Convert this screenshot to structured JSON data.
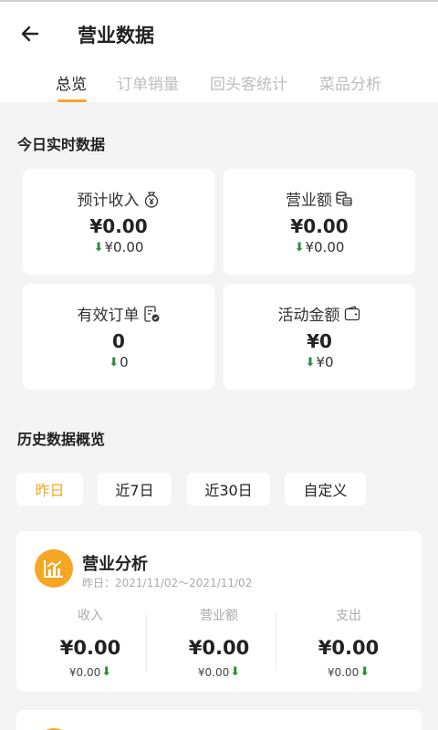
{
  "header": {
    "title": "营业数据",
    "tabs": [
      {
        "label": "总览",
        "active": true
      },
      {
        "label": "订单销量",
        "active": false
      },
      {
        "label": "回头客统计",
        "active": false
      },
      {
        "label": "菜品分析",
        "active": false
      }
    ]
  },
  "realtime": {
    "title": "今日实时数据",
    "cards": [
      {
        "label": "预计收入",
        "icon": "money-bag-icon",
        "value": "¥0.00",
        "delta": "¥0.00"
      },
      {
        "label": "营业额",
        "icon": "coins-icon",
        "value": "¥0.00",
        "delta": "¥0.00"
      },
      {
        "label": "有效订单",
        "icon": "order-check-icon",
        "value": "0",
        "delta": "0"
      },
      {
        "label": "活动金额",
        "icon": "wallet-icon",
        "value": "¥0",
        "delta": "¥0"
      }
    ]
  },
  "history": {
    "title": "历史数据概览",
    "ranges": [
      {
        "label": "昨日",
        "active": true
      },
      {
        "label": "近7日",
        "active": false
      },
      {
        "label": "近30日",
        "active": false
      },
      {
        "label": "自定义",
        "active": false
      }
    ]
  },
  "business_panel": {
    "title": "营业分析",
    "date_range": "昨日：2021/11/02～2021/11/02",
    "metrics": [
      {
        "label": "收入",
        "value": "¥0.00",
        "delta": "¥0.00"
      },
      {
        "label": "营业额",
        "value": "¥0.00",
        "delta": "¥0.00"
      },
      {
        "label": "支出",
        "value": "¥0.00",
        "delta": "¥0.00"
      }
    ]
  },
  "colors": {
    "accent": "#f5a623",
    "down": "#2e8b3d",
    "background": "#f4f4f4"
  }
}
